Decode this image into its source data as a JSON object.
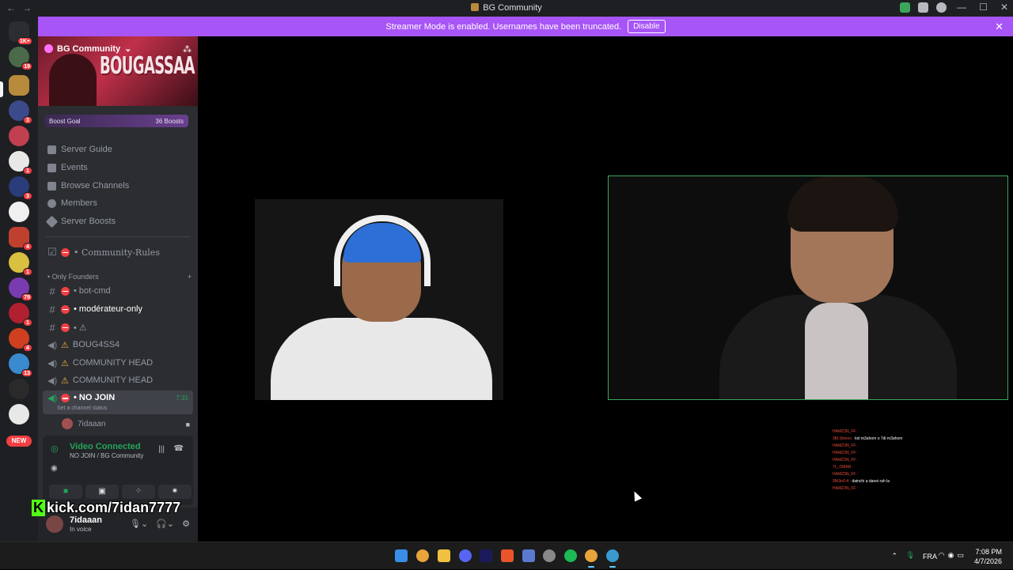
{
  "window": {
    "title": "BG Community",
    "controls": [
      "—",
      "☐",
      "✕"
    ]
  },
  "streamer_banner": {
    "message": "Streamer Mode is enabled. Usernames have been truncated.",
    "button": "Disable"
  },
  "server_rail": {
    "badges": [
      "1K+",
      "19",
      "3",
      "1",
      "3",
      "4",
      "1",
      "79",
      "1",
      "4",
      "13"
    ],
    "new_label": "NEW"
  },
  "server": {
    "name": "BG Community",
    "banner_text": "BOUGASSAA",
    "boost_goal": "Boost Goal",
    "boost_count": "36 Boosts"
  },
  "nav": [
    {
      "label": "Server Guide"
    },
    {
      "label": "Events"
    },
    {
      "label": "Browse Channels"
    },
    {
      "label": "Members"
    },
    {
      "label": "Server Boosts"
    }
  ],
  "channels": {
    "rules": "• Community-Rules",
    "category": "• Only Founders",
    "list": [
      {
        "label": "• bot-cmd",
        "type": "text"
      },
      {
        "label": "• modérateur-only",
        "type": "text"
      },
      {
        "label": "• ⚠",
        "type": "text"
      },
      {
        "label": "BOUG4SS4",
        "type": "voice"
      },
      {
        "label": "COMMUNITY HEAD",
        "type": "voice"
      },
      {
        "label": "COMMUNITY HEAD",
        "type": "voice"
      }
    ],
    "active": {
      "label": "• NO JOIN",
      "time": "7:31",
      "status": "Set a channel status"
    },
    "voice_user": "7idaaan"
  },
  "voice_panel": {
    "title": "Video Connected",
    "subtitle": "NO JOIN / BG Community"
  },
  "user": {
    "name": "7idaaan",
    "status": "In voice"
  },
  "overlay": {
    "kick_url": "kick.com/7idan7777"
  },
  "chat": [
    {
      "name": "HAMZ3N_FF :",
      "text": ""
    },
    {
      "name": "3M.Shinoo :",
      "text": "kol m3ahom o 7di m3ahom"
    },
    {
      "name": "HAMZ3N_FF :",
      "text": ""
    },
    {
      "name": "HAMZ3N_FF :",
      "text": ""
    },
    {
      "name": "HAMZ3N_FF :",
      "text": ""
    },
    {
      "name": "7L_OMAR :",
      "text": ""
    },
    {
      "name": "HAMZ3N_FF :",
      "text": ""
    },
    {
      "name": "3Ni3n0-4 :",
      "text": "dainchi a danei rah la"
    },
    {
      "name": "HAMZ3N_FF :",
      "text": ""
    }
  ],
  "tray": {
    "lang": "FRA",
    "time": "7:08 PM",
    "date": "4/7/2026"
  },
  "colors": {
    "banner": "#a855f7",
    "voice_green": "#23a55a",
    "sidebar": "#2b2d31",
    "rail": "#1e1f22"
  }
}
